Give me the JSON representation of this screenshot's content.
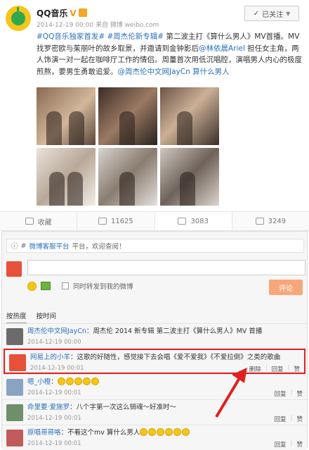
{
  "post": {
    "author": "QQ音乐",
    "verified": "V",
    "meta": "2014-12-19 00:00 来自 微博 weibo.com",
    "follow_label": "已关注",
    "text_parts": [
      {
        "t": "#QQ音乐独家首发#",
        "blue": true
      },
      {
        "t": " "
      },
      {
        "t": "#周杰伦新专辑#",
        "blue": true
      },
      {
        "t": " 第二波主打《算什么男人》MV首播。MV找罗密欧与茱丽叶的故乡取景，并邀请到金钟影后"
      },
      {
        "t": "@林依晨Ariel",
        "blue": true
      },
      {
        "t": " 担任女主角，两人饰演一对一起在咖啡厅工作的情侣。周董首次用低沉唱腔，演唱男人内心的极度煎熬，要男生勇敢追爱。"
      },
      {
        "t": "@周杰伦中文网JayCn",
        "blue": true
      },
      {
        "t": " "
      },
      {
        "t": "算什么男人",
        "blue": true
      }
    ]
  },
  "actions": [
    {
      "label": "收藏",
      "icon": "star-icon"
    },
    {
      "label": "11625",
      "icon": "share-icon"
    },
    {
      "label": "3083",
      "icon": "comment-icon"
    },
    {
      "label": "3249",
      "icon": "like-icon"
    }
  ],
  "comments_box": {
    "notice_prefix": "#",
    "notice_link": "微博客服平台",
    "notice_suffix": "平台，欢迎查阅！",
    "input_value": "",
    "forward_label": "同时转发到我的微博",
    "submit_label": "评论",
    "tabs": [
      "按热度",
      "按时间"
    ]
  },
  "comments": [
    {
      "user": "周杰伦中文网JayCn",
      "text": "：周杰伦 2014 新专辑 第二波主打《算什么男人》MV 首播",
      "time": "2014-12-19 00:00",
      "ops": [],
      "highlight": false,
      "avcolor": "#6b6b6b"
    },
    {
      "user": "网易上的小羊",
      "text": "：这歌的好随性，感觉接下去会唱《爱不爱我》《不爱拉倒》之类的歌曲",
      "time": "2014-12-19 00:01",
      "ops": [
        "删除",
        "回复",
        "赞"
      ],
      "highlight": true,
      "avcolor": "#e8503a"
    },
    {
      "user": "嗯_小橙",
      "text": "：",
      "time": "2014-12-19 00:01",
      "ops": [
        "回复",
        "赞"
      ],
      "highlight": false,
      "avcolor": "#8aa3c2",
      "emojis": 5
    },
    {
      "user": "命里要·爱施罗",
      "text": "：八个字第一次这么销魂～好准时～",
      "time": "2014-12-19 00:01",
      "ops": [
        "回复",
        "赞"
      ],
      "highlight": false,
      "avcolor": "#6f8f6a"
    },
    {
      "user": "原唱哥哥咯",
      "text": "：不看这个mv 算什么男人",
      "time": "2014-12-19 00:01",
      "ops": [
        "回复",
        "赞"
      ],
      "highlight": false,
      "avcolor": "#c25b5b",
      "emojis": 6
    }
  ],
  "colors": {
    "accent": "#2a6fbd",
    "highlight": "#e02020",
    "submit": "#f7a77a"
  }
}
